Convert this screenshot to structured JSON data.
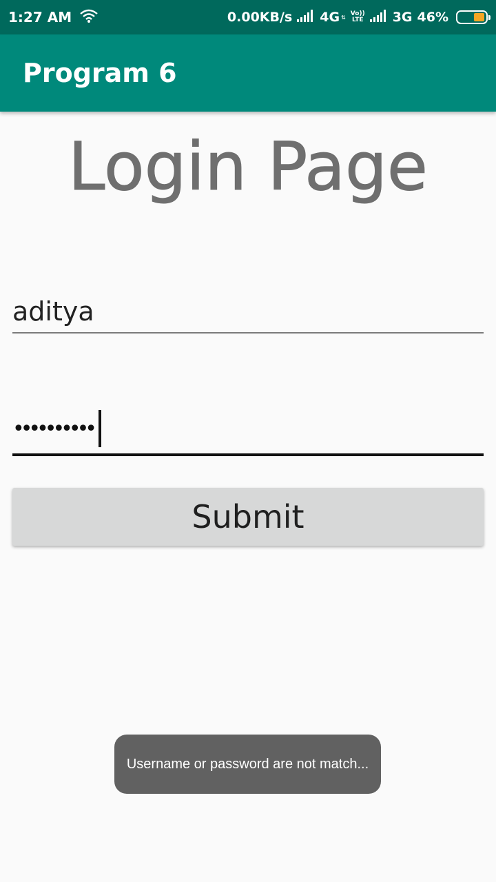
{
  "status_bar": {
    "time": "1:27 AM",
    "network_speed": "0.00KB/s",
    "network_1": "4G",
    "volte_top": "Vo))",
    "volte_bottom": "LTE",
    "network_2": "3G",
    "battery": "46%",
    "icons": [
      "wifi-icon",
      "signal-icon",
      "battery-icon"
    ],
    "battery_level": 0.46,
    "battery_color": "#f5a623"
  },
  "app_bar": {
    "title": "Program 6",
    "color": "#00897b",
    "status_color": "#00695c"
  },
  "page": {
    "heading": "Login Page"
  },
  "form": {
    "username_value": "aditya",
    "password_mask": "••••••••••",
    "submit_label": "Submit"
  },
  "toast": {
    "message": "Username or password are not match..."
  }
}
